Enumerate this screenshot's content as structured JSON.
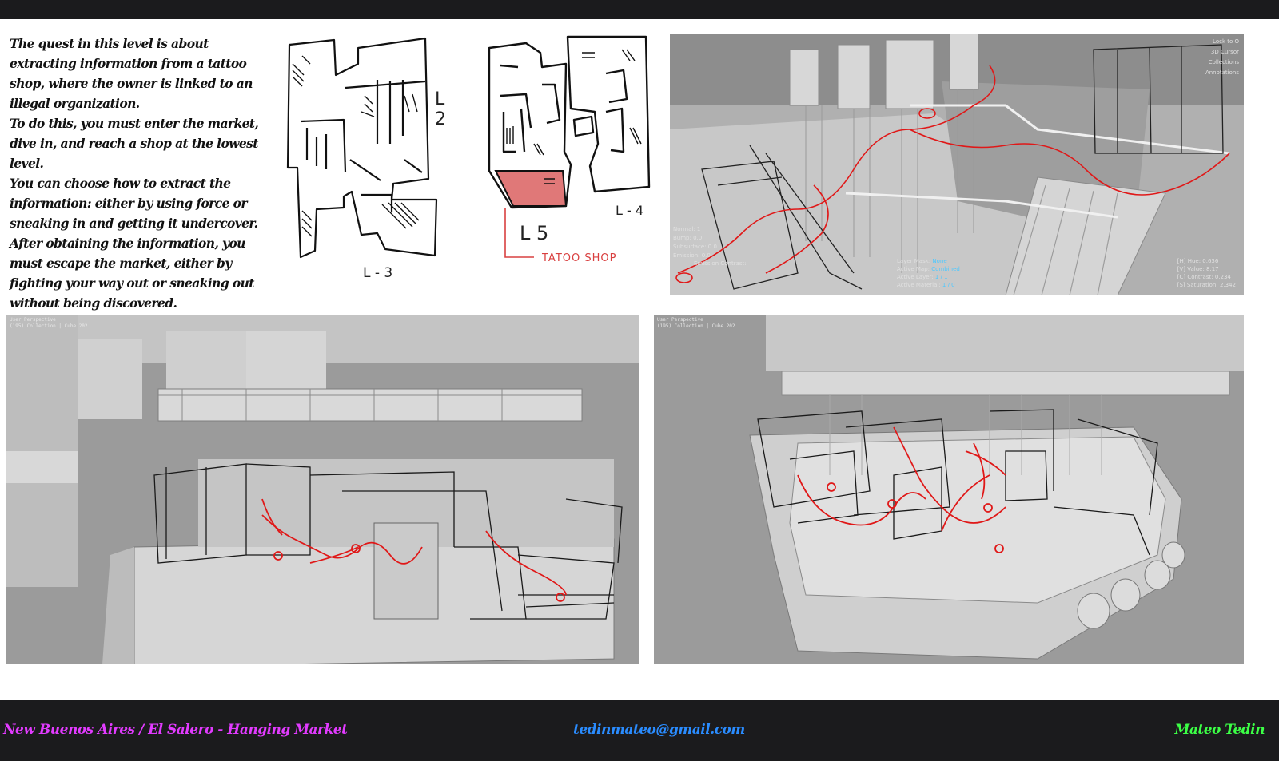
{
  "quest_text": [
    "The quest in this level is about extracting information from a tattoo shop, where the owner is linked to an illegal organization.",
    "To do this, you must enter the market, dive in, and reach a shop at the lowest level.",
    "You can choose how to extract the information: either by using force or sneaking in and getting it undercover.",
    "After obtaining the information, you must escape the market, either by fighting your way out or sneaking out without being discovered."
  ],
  "plans": {
    "level_3_label": "L - 3",
    "level_2_label": "L 2",
    "level_4_label": "L - 4",
    "level_5_label": "L 5",
    "tattoo_label": "TATOO SHOP"
  },
  "viewport_top_right": {
    "panel_items": [
      "Lock to O",
      "3D Cursor",
      "Collections",
      "Annotations"
    ],
    "props_left": [
      "Normal: 1",
      "Bump: 0.0",
      "Subsurface: 0.0",
      "Emission: 0.0"
    ],
    "props_mid": [
      {
        "k": "Layer Mask:",
        "v": "None"
      },
      {
        "k": "Active Map:",
        "v": "Combined"
      },
      {
        "k": "Active Layer:",
        "v": "1 / 1"
      },
      {
        "k": "Active Material:",
        "v": "1 / 0"
      }
    ],
    "emission_contrast": "Emission Contrast:",
    "props_right": [
      "[H] Hue: 0.636",
      "[V] Value: 8.17",
      "[C] Contrast: 0.234",
      "[S] Saturation: 2.342"
    ]
  },
  "viewport_bottom_left": {
    "line1": "User Perspective",
    "line2": "(195) Collection | Cube.202"
  },
  "viewport_bottom_right": {
    "line1": "User Perspective",
    "line2": "(195) Collection | Cube.202"
  },
  "footer": {
    "project": "New Buenos Aires / El Salero - Hanging Market",
    "email": "tedinmateo@gmail.com",
    "author": "Mateo Tedin"
  },
  "colors": {
    "bar": "#1b1b1d",
    "project": "#e23bff",
    "email": "#2a8cff",
    "author": "#3cff46",
    "route": "#e01818",
    "tattoo_fill": "#e07878"
  }
}
